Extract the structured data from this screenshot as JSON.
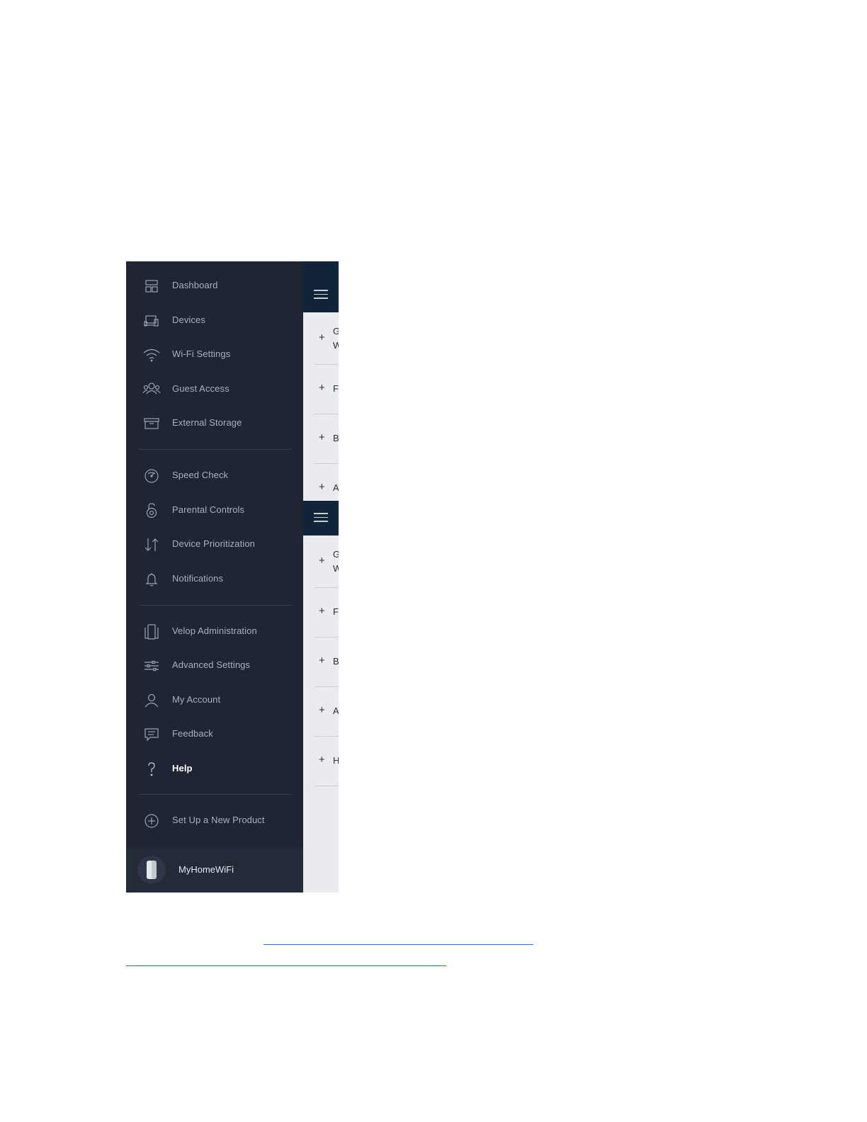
{
  "menu": {
    "items": [
      {
        "label": "Dashboard",
        "icon": "dashboard-icon"
      },
      {
        "label": "Devices",
        "icon": "devices-icon"
      },
      {
        "label": "Wi-Fi Settings",
        "icon": "wifi-icon"
      },
      {
        "label": "Guest Access",
        "icon": "guest-icon"
      },
      {
        "label": "External Storage",
        "icon": "storage-icon"
      },
      {
        "label": "Speed Check",
        "icon": "speedometer-icon"
      },
      {
        "label": "Parental Controls",
        "icon": "lock-icon"
      },
      {
        "label": "Device Prioritization",
        "icon": "arrows-icon"
      },
      {
        "label": "Notifications",
        "icon": "bell-icon"
      },
      {
        "label": "Velop Administration",
        "icon": "node-icon"
      },
      {
        "label": "Advanced Settings",
        "icon": "sliders-icon"
      },
      {
        "label": "My Account",
        "icon": "person-icon"
      },
      {
        "label": "Feedback",
        "icon": "chat-icon"
      },
      {
        "label": "Help",
        "icon": "question-icon"
      },
      {
        "label": "Set Up a New Product",
        "icon": "plus-circle-icon"
      }
    ],
    "active": "Help"
  },
  "network": {
    "name": "MyHomeWiFi",
    "icon": "velop-node-icon"
  },
  "behind": {
    "faq_top": [
      {
        "plus": "+",
        "text": "G\nW"
      },
      {
        "plus": "+",
        "text": "F"
      },
      {
        "plus": "+",
        "text": "B"
      },
      {
        "plus": "+",
        "text": "A"
      }
    ],
    "faq_bottom": [
      {
        "plus": "+",
        "text": "G\nW"
      },
      {
        "plus": "+",
        "text": "F"
      },
      {
        "plus": "+",
        "text": "B"
      },
      {
        "plus": "+",
        "text": "A"
      },
      {
        "plus": "+",
        "text": "H"
      }
    ]
  },
  "colors": {
    "drawer": "#1f2533",
    "header": "#11243a",
    "link": "#3a6fc4"
  }
}
